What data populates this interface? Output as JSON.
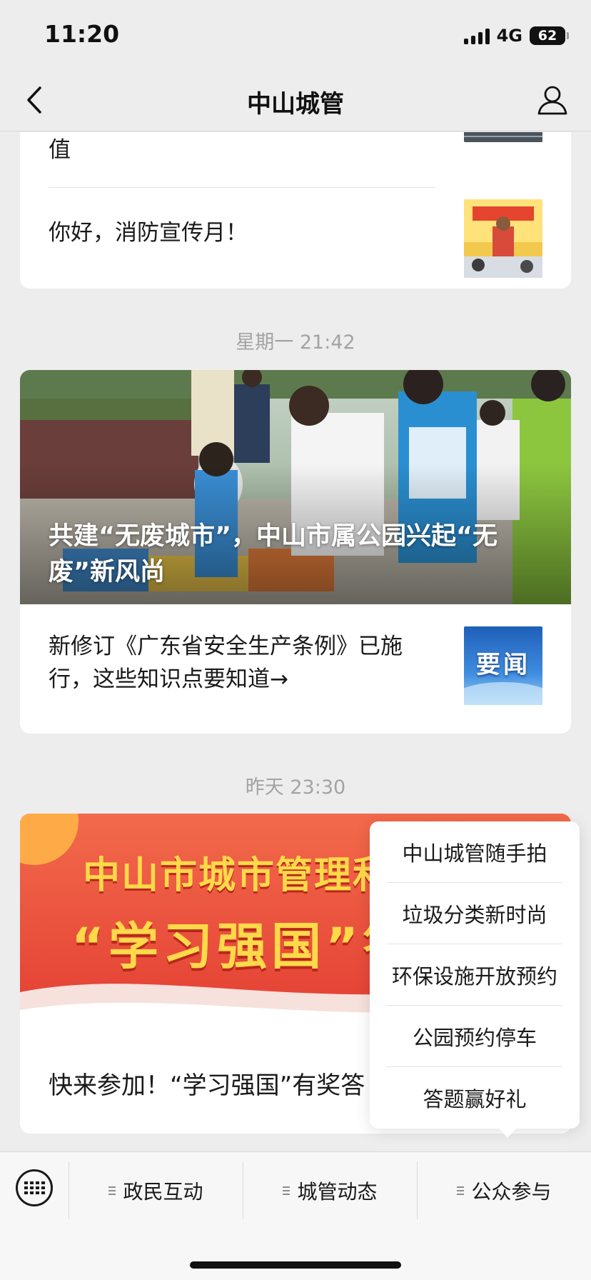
{
  "status_bar": {
    "time": "11:20",
    "network": "4G",
    "battery": "62"
  },
  "nav": {
    "title": "中山城管",
    "back_icon": "chevron-left-icon",
    "profile_icon": "person-icon"
  },
  "feed": {
    "group1": {
      "partial_text": "值",
      "article": {
        "title": "你好，消防宣传月！"
      }
    },
    "timestamp1": "星期一 21:42",
    "group2": {
      "hero_title": "共建“无废城市”，中山市属公园兴起“无废”新风尚",
      "article": {
        "title": "新修订《广东省安全生产条例》已施行，这些知识点要知道→",
        "thumb_text": "要闻"
      }
    },
    "timestamp2": "昨天 23:30",
    "group3": {
      "banner_line1": "中山市城市管理和综",
      "banner_line2": "“学习强国”答",
      "article": {
        "title": "快来参加！“学习强国”有奖答"
      }
    }
  },
  "submenu": {
    "items": [
      "中山城管随手拍",
      "垃圾分类新时尚",
      "环保设施开放预约",
      "公园预约停车",
      "答题赢好礼"
    ]
  },
  "bottom_menu": {
    "keyboard_icon": "keyboard-icon",
    "tabs": [
      "政民互动",
      "城管动态",
      "公众参与"
    ]
  },
  "colors": {
    "background": "#ededed",
    "card": "#ffffff",
    "timestamp": "#a3a3a3",
    "banner_red": "#e9493b",
    "banner_gold": "#ffd94a"
  }
}
